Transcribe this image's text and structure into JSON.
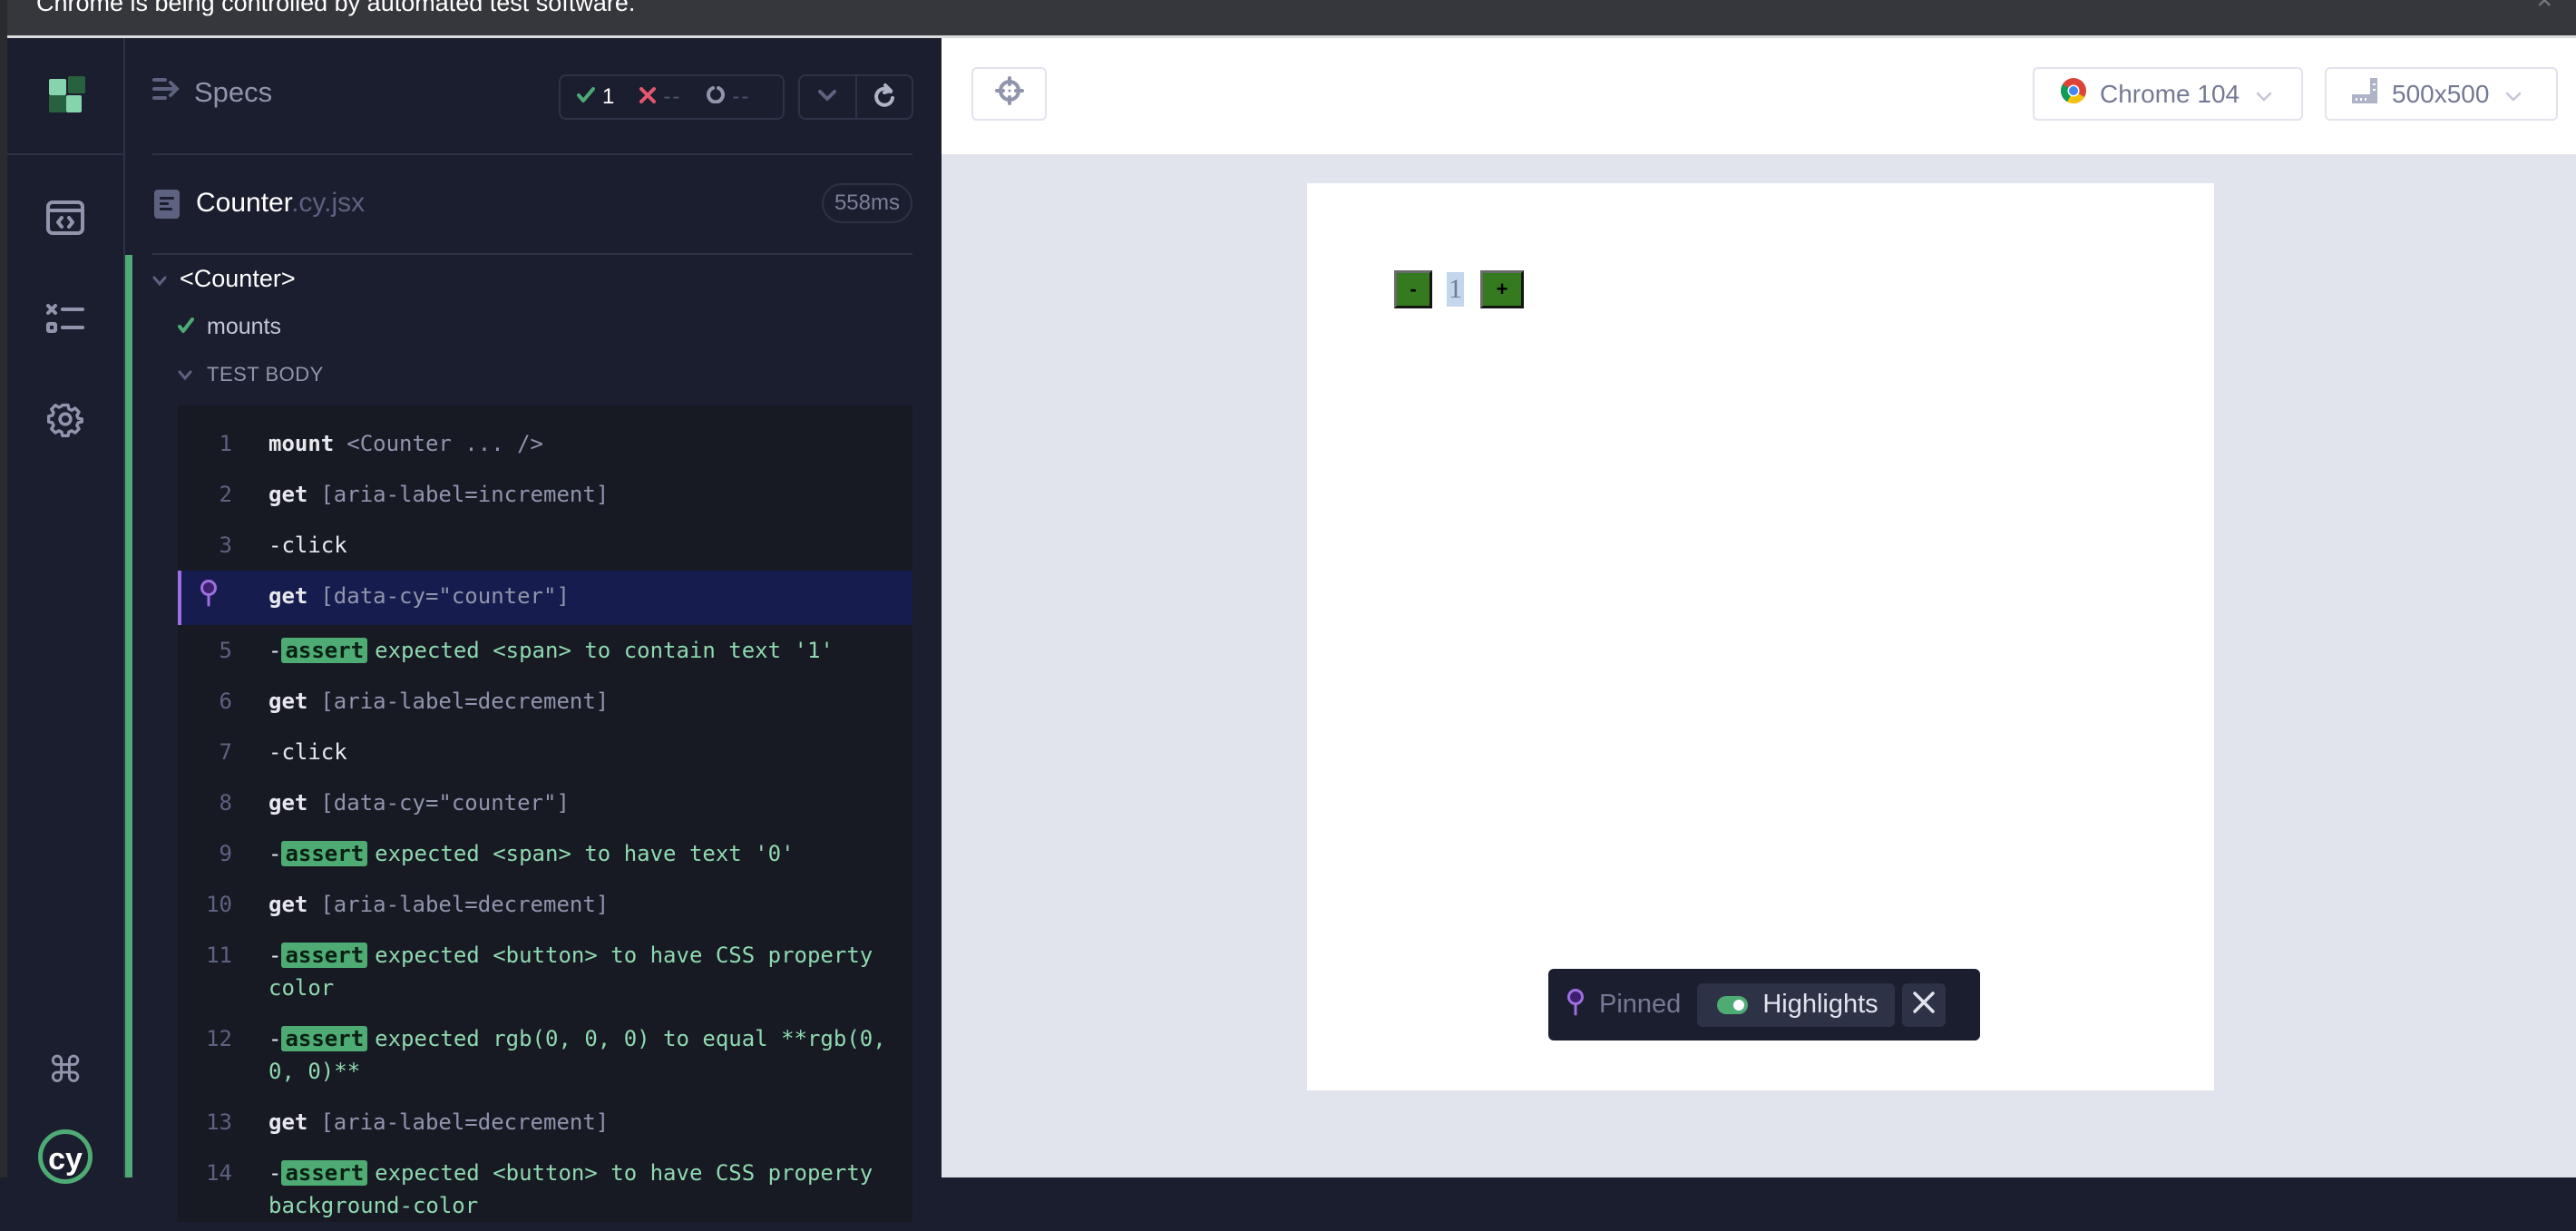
{
  "infobar": {
    "message": "Chrome is being controlled by automated test software.",
    "close_glyph": "×"
  },
  "nav": {
    "items": [
      {
        "name": "specs-nav",
        "icon": "code-window-icon"
      },
      {
        "name": "runs-nav",
        "icon": "test-results-icon"
      },
      {
        "name": "settings-nav",
        "icon": "gear-icon"
      }
    ],
    "bottom": [
      {
        "name": "keyboard-shortcuts",
        "icon": "command-key-icon"
      },
      {
        "name": "cypress-logo",
        "icon": "cypress-logo-icon",
        "text": "cy"
      }
    ]
  },
  "reporter": {
    "specs_label": "Specs",
    "stats": {
      "passed": "1",
      "failed": "--",
      "pending": "--"
    },
    "spec": {
      "name": "Counter",
      "ext": ".cy.jsx",
      "duration": "558ms"
    },
    "suite": "<Counter>",
    "test": "mounts",
    "section": "TEST BODY",
    "commands": [
      {
        "num": "1",
        "type": "cmd",
        "name": "mount",
        "arg": "<Counter ... />"
      },
      {
        "num": "2",
        "type": "cmd",
        "name": "get",
        "arg": "[aria-label=increment]"
      },
      {
        "num": "3",
        "type": "child",
        "name": "-click",
        "arg": ""
      },
      {
        "num": "4",
        "type": "cmd",
        "name": "get",
        "arg": "[data-cy=\"counter\"]",
        "pinned": true
      },
      {
        "num": "5",
        "type": "assert",
        "name": "assert",
        "message": "expected <span> to contain text '1'"
      },
      {
        "num": "6",
        "type": "cmd",
        "name": "get",
        "arg": "[aria-label=decrement]"
      },
      {
        "num": "7",
        "type": "child",
        "name": "-click",
        "arg": ""
      },
      {
        "num": "8",
        "type": "cmd",
        "name": "get",
        "arg": "[data-cy=\"counter\"]"
      },
      {
        "num": "9",
        "type": "assert",
        "name": "assert",
        "message": "expected <span> to have text '0'"
      },
      {
        "num": "10",
        "type": "cmd",
        "name": "get",
        "arg": "[aria-label=decrement]"
      },
      {
        "num": "11",
        "type": "assert",
        "name": "assert",
        "message": "expected <button> to have CSS property color"
      },
      {
        "num": "12",
        "type": "assert",
        "name": "assert",
        "message": "expected rgb(0, 0, 0) to equal **rgb(0, 0, 0)**"
      },
      {
        "num": "13",
        "type": "cmd",
        "name": "get",
        "arg": "[aria-label=decrement]"
      },
      {
        "num": "14",
        "type": "assert",
        "name": "assert",
        "message": "expected <button> to have CSS property background-color"
      }
    ]
  },
  "aut": {
    "browser": "Chrome 104",
    "viewport": "500x500",
    "counter": {
      "decrement_label": "-",
      "value": "1",
      "increment_label": "+"
    },
    "pinned_bar": {
      "pinned_label": "Pinned",
      "highlights_label": "Highlights",
      "highlights_on": true
    }
  },
  "colors": {
    "pass": "#4eab74",
    "fail": "#e45770",
    "pin": "#9d6fe0",
    "panel_bg": "#1b1e2e",
    "aut_bg": "#e1e3ed"
  }
}
